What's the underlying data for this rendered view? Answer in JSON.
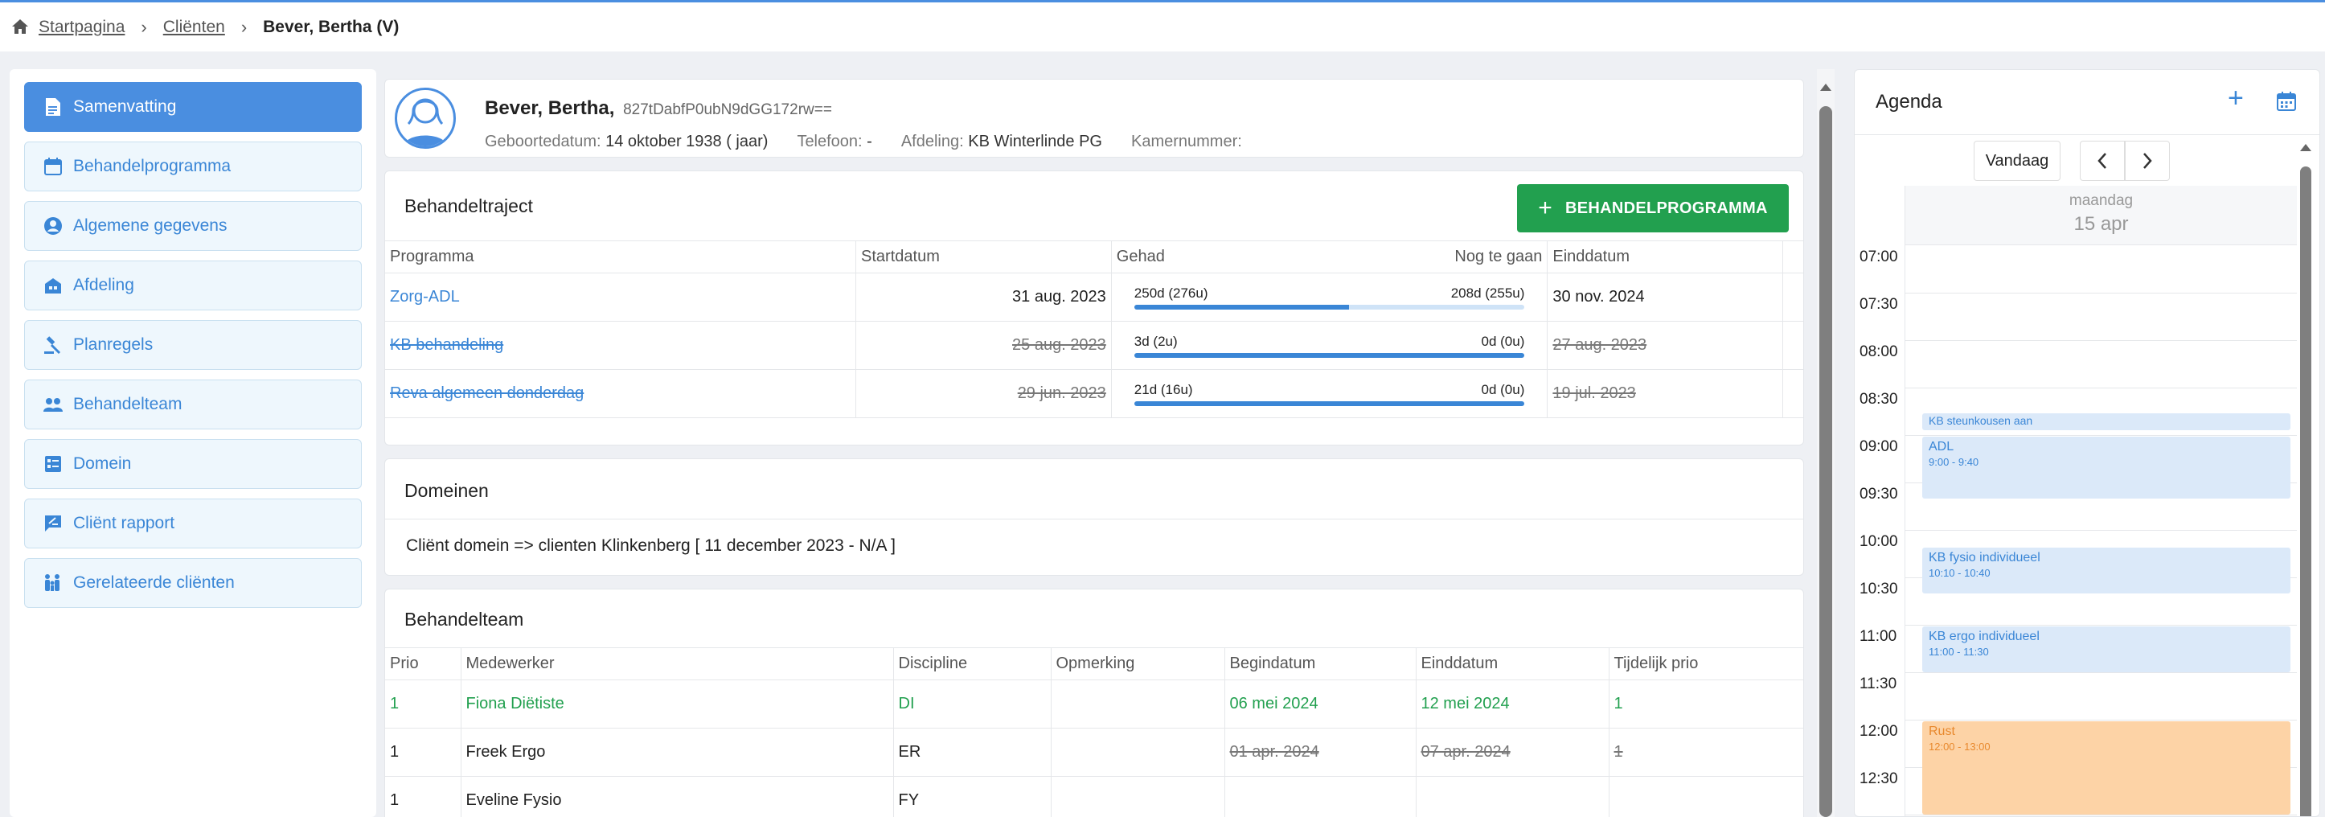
{
  "breadcrumb": {
    "home": "Startpagina",
    "clients": "Cliënten",
    "current": "Bever, Bertha (V)"
  },
  "sidebar": {
    "items": [
      {
        "label": "Samenvatting",
        "icon": "document-icon",
        "active": true
      },
      {
        "label": "Behandelprogramma",
        "icon": "calendar-icon"
      },
      {
        "label": "Algemene gegevens",
        "icon": "account-circle-icon"
      },
      {
        "label": "Afdeling",
        "icon": "building-icon"
      },
      {
        "label": "Planregels",
        "icon": "gavel-icon"
      },
      {
        "label": "Behandelteam",
        "icon": "group-icon"
      },
      {
        "label": "Domein",
        "icon": "domain-list-icon"
      },
      {
        "label": "Cliënt rapport",
        "icon": "report-icon"
      },
      {
        "label": "Gerelateerde cliënten",
        "icon": "family-icon"
      }
    ]
  },
  "patient": {
    "name": "Bever, Bertha,",
    "id": "827tDabfP0ubN9dGG172rw==",
    "birth_label": "Geboortedatum:",
    "birth_value": "14 oktober 1938 ( jaar)",
    "phone_label": "Telefoon:",
    "phone_value": "-",
    "dept_label": "Afdeling:",
    "dept_value": "KB Winterlinde PG",
    "room_label": "Kamernummer:",
    "room_value": ""
  },
  "traject": {
    "title": "Behandeltraject",
    "button_label": "BEHANDELPROGRAMMA",
    "headers": {
      "programma": "Programma",
      "start": "Startdatum",
      "gehad": "Gehad",
      "nog": "Nog te gaan",
      "eind": "Einddatum"
    },
    "rows": [
      {
        "programma": "Zorg-ADL",
        "start": "31 aug. 2023",
        "gehad": "250d (276u)",
        "nog": "208d (255u)",
        "progress": 0.55,
        "eind": "30 nov. 2024",
        "ended": false
      },
      {
        "programma": "KB behandeling",
        "start": "25 aug. 2023",
        "gehad": "3d (2u)",
        "nog": "0d (0u)",
        "progress": 1.0,
        "eind": "27 aug. 2023",
        "ended": true
      },
      {
        "programma": "Reva algemeen donderdag",
        "start": "29 jun. 2023",
        "gehad": "21d (16u)",
        "nog": "0d (0u)",
        "progress": 1.0,
        "eind": "19 jul. 2023",
        "ended": true
      }
    ]
  },
  "domeinen": {
    "title": "Domeinen",
    "line": "Cliënt domein => clienten Klinkenberg [ 11 december 2023 - N/A ]"
  },
  "team": {
    "title": "Behandelteam",
    "headers": {
      "prio": "Prio",
      "medewerker": "Medewerker",
      "discipline": "Discipline",
      "opmerking": "Opmerking",
      "begin": "Begindatum",
      "eind": "Einddatum",
      "tijdelijk": "Tijdelijk prio"
    },
    "rows": [
      {
        "prio": "1",
        "medewerker": "Fiona Diëtiste",
        "discipline": "DI",
        "opmerking": "",
        "begin": "06 mei 2024",
        "eind": "12 mei 2024",
        "tijdelijk": "1",
        "style": "green"
      },
      {
        "prio": "1",
        "medewerker": "Freek Ergo",
        "discipline": "ER",
        "opmerking": "",
        "begin": "01 apr. 2024",
        "eind": "07 apr. 2024",
        "tijdelijk": "1",
        "style": "ended"
      },
      {
        "prio": "1",
        "medewerker": "Eveline Fysio",
        "discipline": "FY",
        "opmerking": "",
        "begin": "",
        "eind": "",
        "tijdelijk": "",
        "style": "normal"
      }
    ]
  },
  "agenda": {
    "title": "Agenda",
    "today_label": "Vandaag",
    "day_name": "maandag",
    "day_date": "15 apr",
    "times": [
      "07:00",
      "07:30",
      "08:00",
      "08:30",
      "09:00",
      "09:30",
      "10:00",
      "10:30",
      "11:00",
      "11:30",
      "12:00",
      "12:30"
    ],
    "events": [
      {
        "title": "KB steunkousen aan",
        "time": "",
        "color": "blue",
        "start": 8.75,
        "end": 8.95
      },
      {
        "title": "ADL",
        "time": "9:00 - 9:40",
        "color": "blue",
        "start": 9.0,
        "end": 9.6667
      },
      {
        "title": "KB fysio individueel",
        "time": "10:10 - 10:40",
        "color": "blue",
        "start": 10.1667,
        "end": 10.6667
      },
      {
        "title": "KB ergo individueel",
        "time": "11:00 - 11:30",
        "color": "blue",
        "start": 11.0,
        "end": 11.5
      },
      {
        "title": "Rust",
        "time": "12:00 - 13:00",
        "color": "orange",
        "start": 12.0,
        "end": 13.0
      }
    ]
  },
  "colors": {
    "accent": "#4a8ee0",
    "link": "#3a86d6",
    "success": "#22a04f",
    "event_blue": "#dbe9f9",
    "event_orange": "#fdd3a6"
  }
}
